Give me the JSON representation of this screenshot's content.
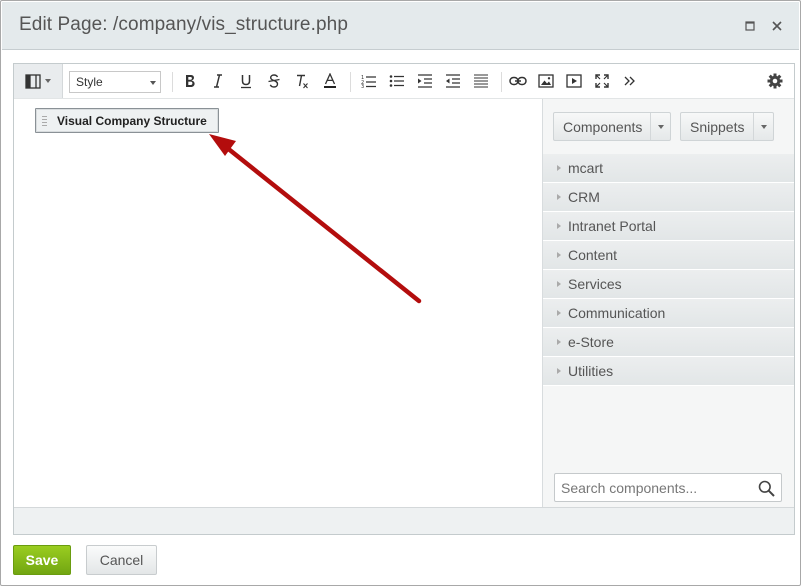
{
  "dialog": {
    "title": "Edit Page: /company/vis_structure.php"
  },
  "toolbar": {
    "style_select_value": "Style",
    "tools": [
      {
        "name": "bold-icon"
      },
      {
        "name": "italic-icon"
      },
      {
        "name": "underline-icon"
      },
      {
        "name": "strikethrough-icon"
      },
      {
        "name": "clear-format-icon"
      },
      {
        "name": "font-color-icon"
      },
      {
        "name": "ordered-list-icon"
      },
      {
        "name": "unordered-list-icon"
      },
      {
        "name": "indent-icon"
      },
      {
        "name": "outdent-icon"
      },
      {
        "name": "justify-icon"
      },
      {
        "name": "link-icon"
      },
      {
        "name": "image-icon"
      },
      {
        "name": "video-icon"
      },
      {
        "name": "fullscreen-icon"
      },
      {
        "name": "more-icon"
      },
      {
        "name": "settings-icon"
      }
    ]
  },
  "editor": {
    "component_label": "Visual Company Structure"
  },
  "sidepanel": {
    "components_label": "Components",
    "snippets_label": "Snippets",
    "items": [
      {
        "label": "mcart"
      },
      {
        "label": "CRM"
      },
      {
        "label": "Intranet Portal"
      },
      {
        "label": "Content"
      },
      {
        "label": "Services"
      },
      {
        "label": "Communication"
      },
      {
        "label": "e-Store"
      },
      {
        "label": "Utilities"
      }
    ],
    "search_placeholder": "Search components..."
  },
  "footer": {
    "save_label": "Save",
    "cancel_label": "Cancel"
  },
  "colors": {
    "annotation_arrow": "#b30d0d",
    "save_button": "#86b817"
  }
}
